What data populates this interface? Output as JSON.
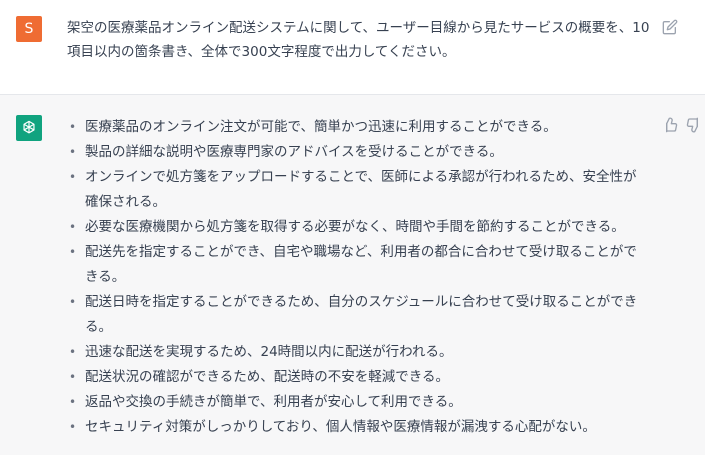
{
  "user": {
    "avatar_letter": "S",
    "avatar_color": "#ef6c33",
    "message": "架空の医療薬品オンライン配送システムに関して、ユーザー目線から見たサービスの概要を、10項目以内の箇条書き、全体で300文字程度で出力してください。",
    "edit_icon": "edit-icon"
  },
  "assistant": {
    "avatar_icon": "openai-logo-icon",
    "avatar_color": "#10a37f",
    "bullet": "•",
    "items": [
      "医療薬品のオンライン注文が可能で、簡単かつ迅速に利用することができる。",
      "製品の詳細な説明や医療専門家のアドバイスを受けることができる。",
      "オンラインで処方箋をアップロードすることで、医師による承認が行われるため、安全性が確保される。",
      "必要な医療機関から処方箋を取得する必要がなく、時間や手間を節約することができる。",
      "配送先を指定することができ、自宅や職場など、利用者の都合に合わせて受け取ることができる。",
      "配送日時を指定することができるため、自分のスケジュールに合わせて受け取ることができる。",
      "迅速な配送を実現するため、24時間以内に配送が行われる。",
      "配送状況の確認ができるため、配送時の不安を軽減できる。",
      "返品や交換の手続きが簡単で、利用者が安心して利用できる。",
      "セキュリティ対策がしっかりしており、個人情報や医療情報が漏洩する心配がない。"
    ],
    "feedback_icons": [
      "thumbs-up-icon",
      "thumbs-down-icon"
    ]
  }
}
